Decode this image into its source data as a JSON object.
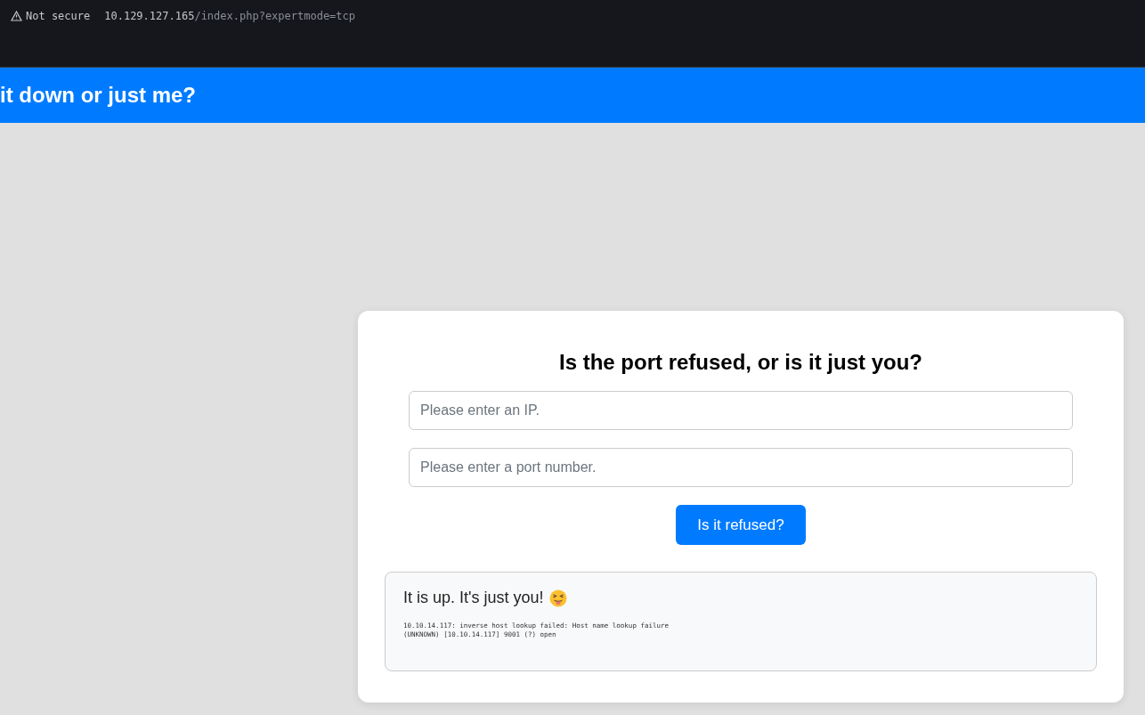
{
  "browser": {
    "security": "Not secure",
    "url_host": "10.129.127.165",
    "url_path": "/index.php?expertmode=tcp"
  },
  "header": {
    "title": "it down or just me?"
  },
  "card": {
    "heading": "Is the port refused, or is it just you?",
    "fields": [
      {
        "placeholder": "Please enter an IP."
      },
      {
        "placeholder": "Please enter a port number."
      }
    ],
    "button": "Is it refused?",
    "result": {
      "message": "It is up. It's just you!",
      "log": [
        "10.10.14.117: inverse host lookup failed: Host name lookup failure",
        "(UNKNOWN) [10.10.14.117] 9001 (?) open"
      ]
    }
  }
}
